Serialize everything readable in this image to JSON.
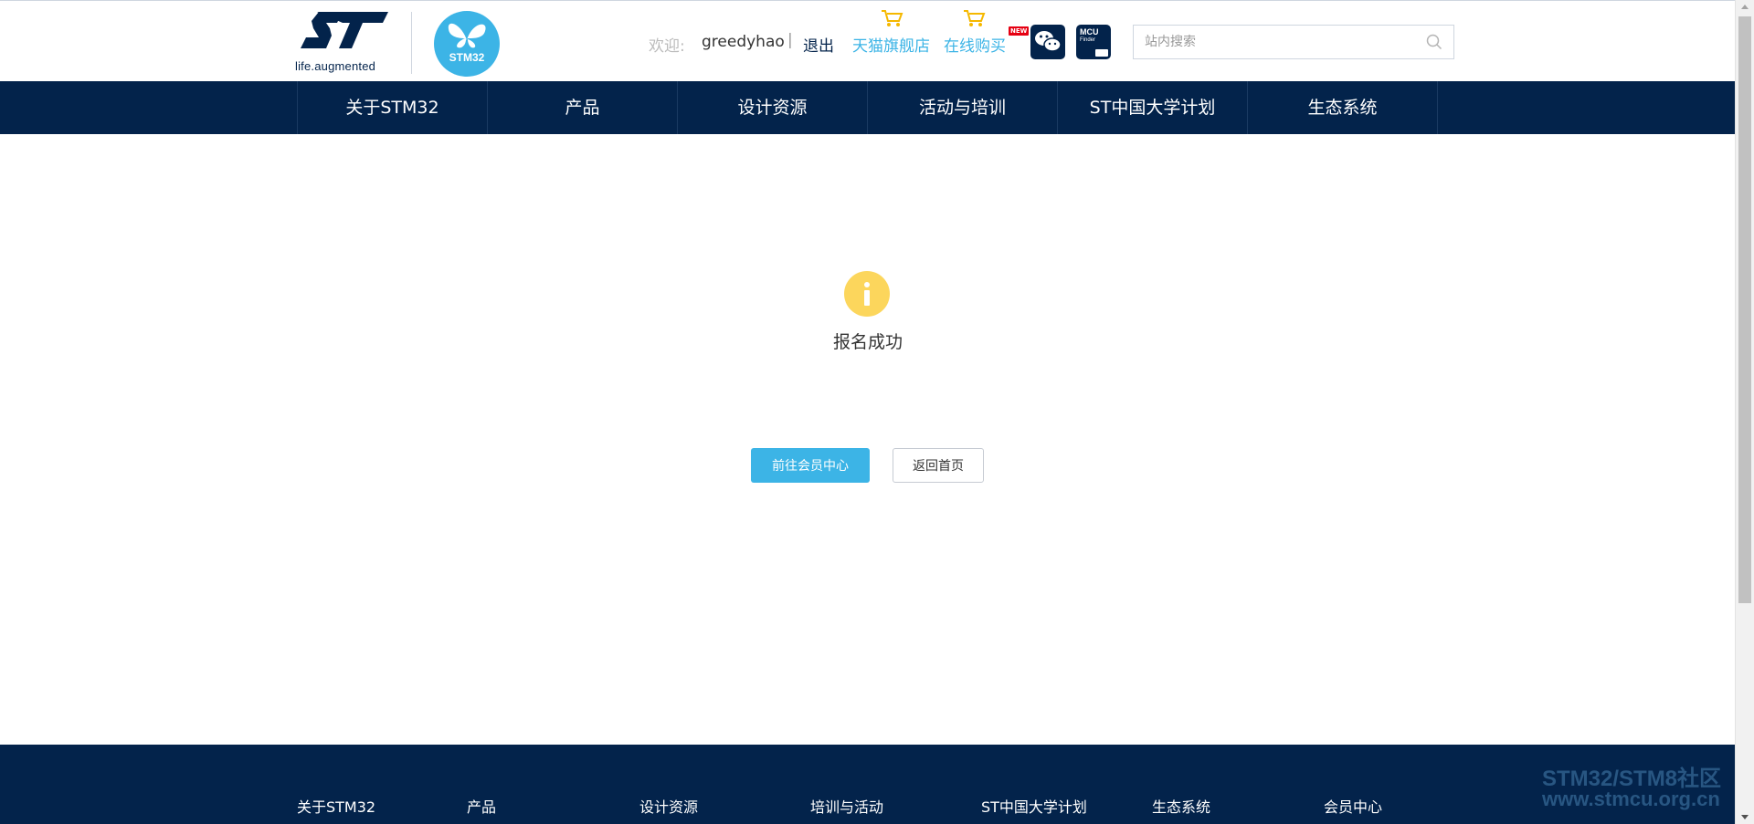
{
  "header": {
    "logo_tagline": "life.augmented",
    "stm_logo_text": "STM32",
    "welcome_label": "欢迎:",
    "username": "greedyhao",
    "separator": "|",
    "logout": "退出",
    "tmall_store": "天猫旗舰店",
    "online_buy": "在线购买",
    "new_badge": "NEW",
    "mcu_finder_line1": "MCU",
    "mcu_finder_line2": "Finder",
    "search_placeholder": "站内搜索"
  },
  "nav": {
    "items": [
      "关于STM32",
      "产品",
      "设计资源",
      "活动与培训",
      "ST中国大学计划",
      "生态系统"
    ]
  },
  "main": {
    "message": "报名成功",
    "primary_button": "前往会员中心",
    "secondary_button": "返回首页"
  },
  "footer": {
    "links": [
      "关于STM32",
      "产品",
      "设计资源",
      "培训与活动",
      "ST中国大学计划",
      "生态系统",
      "会员中心"
    ]
  },
  "watermark": {
    "line1": "STM32/STM8社区",
    "line2": "www.stmcu.org.cn"
  },
  "colors": {
    "brand_navy": "#03234b",
    "brand_blue": "#3cb4e6",
    "info_yellow": "#fcd65c"
  }
}
